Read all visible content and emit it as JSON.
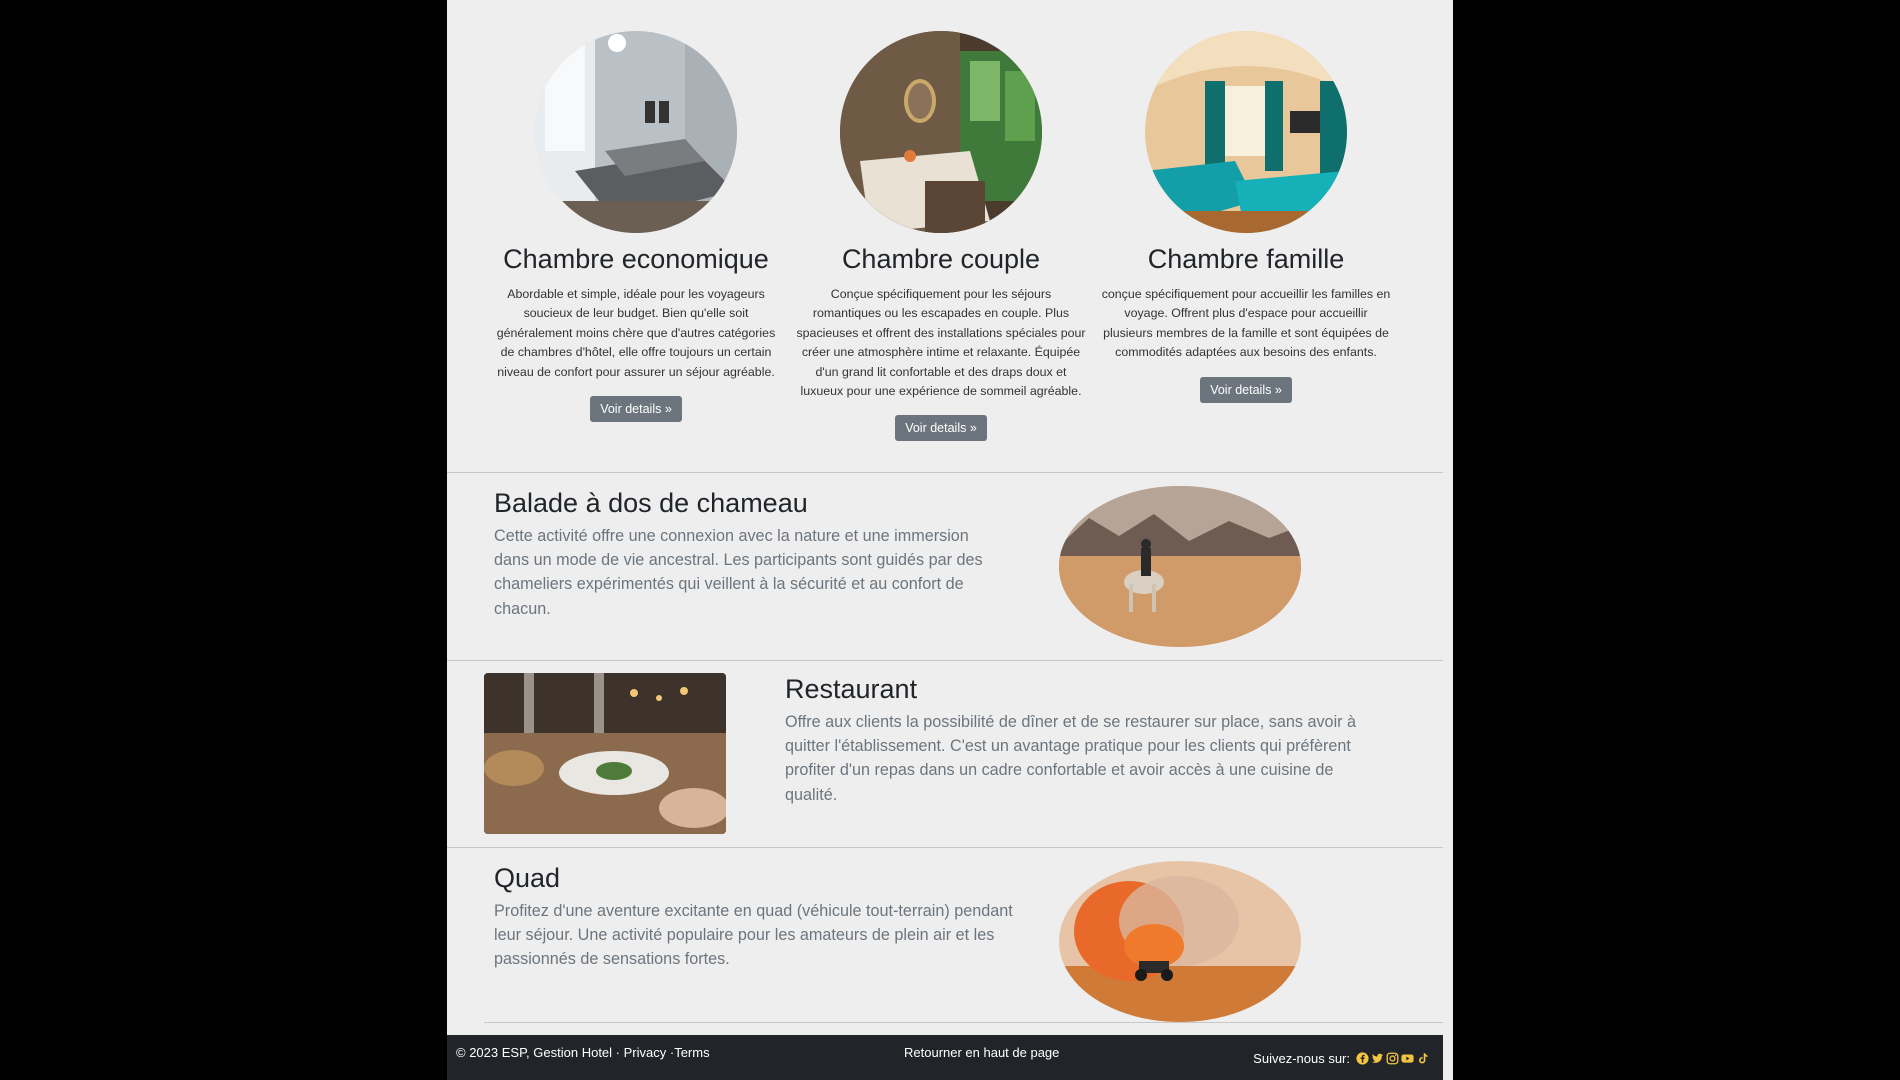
{
  "rooms": [
    {
      "title": "Chambre economique",
      "description": "Abordable et simple, idéale pour les voyageurs soucieux de leur budget. Bien qu'elle soit généralement moins chère que d'autres catégories de chambres d'hôtel, elle offre toujours un certain niveau de confort pour assurer un séjour agréable.",
      "button": "Voir details »"
    },
    {
      "title": "Chambre couple",
      "description": "Conçue spécifiquement pour les séjours romantiques ou les escapades en couple. Plus spacieuses et offrent des installations spéciales pour créer une atmosphère intime et relaxante. Équipée d'un grand lit confortable et des draps doux et luxueux pour une expérience de sommeil agréable.",
      "button": "Voir details »"
    },
    {
      "title": "Chambre famille",
      "description": "conçue spécifiquement pour accueillir les familles en voyage. Offrent plus d'espace pour accueillir plusieurs membres de la famille et sont équipées de commodités adaptées aux besoins des enfants.",
      "button": "Voir details »"
    }
  ],
  "features": {
    "camel": {
      "title": "Balade à dos de chameau",
      "text": "Cette activité offre une connexion avec la nature et une immersion dans un mode de vie ancestral. Les participants sont guidés par des chameliers expérimentés qui veillent à la sécurité et au confort de chacun."
    },
    "restaurant": {
      "title": "Restaurant",
      "text": "Offre aux clients la possibilité de dîner et de se restaurer sur place, sans avoir à quitter l'établissement. C'est un avantage pratique pour les clients qui préfèrent profiter d'un repas dans un cadre confortable et avoir accès à une cuisine de qualité."
    },
    "quad": {
      "title": "Quad",
      "text": "Profitez d'une aventure excitante en quad (véhicule tout-terrain) pendant leur séjour. Une activité populaire pour les amateurs de plein air et les passionnés de sensations fortes."
    }
  },
  "footer": {
    "copyright": "© 2023 ESP, Gestion Hotel · ",
    "privacy": "Privacy",
    "separator": " ·",
    "terms": "Terms",
    "back_to_top": "Retourner en haut de page",
    "follow": "Suivez-nous sur:",
    "social_icons": [
      "facebook-icon",
      "twitter-icon",
      "instagram-icon",
      "youtube-icon",
      "tiktok-icon"
    ],
    "icon_color": "#f4c542"
  }
}
